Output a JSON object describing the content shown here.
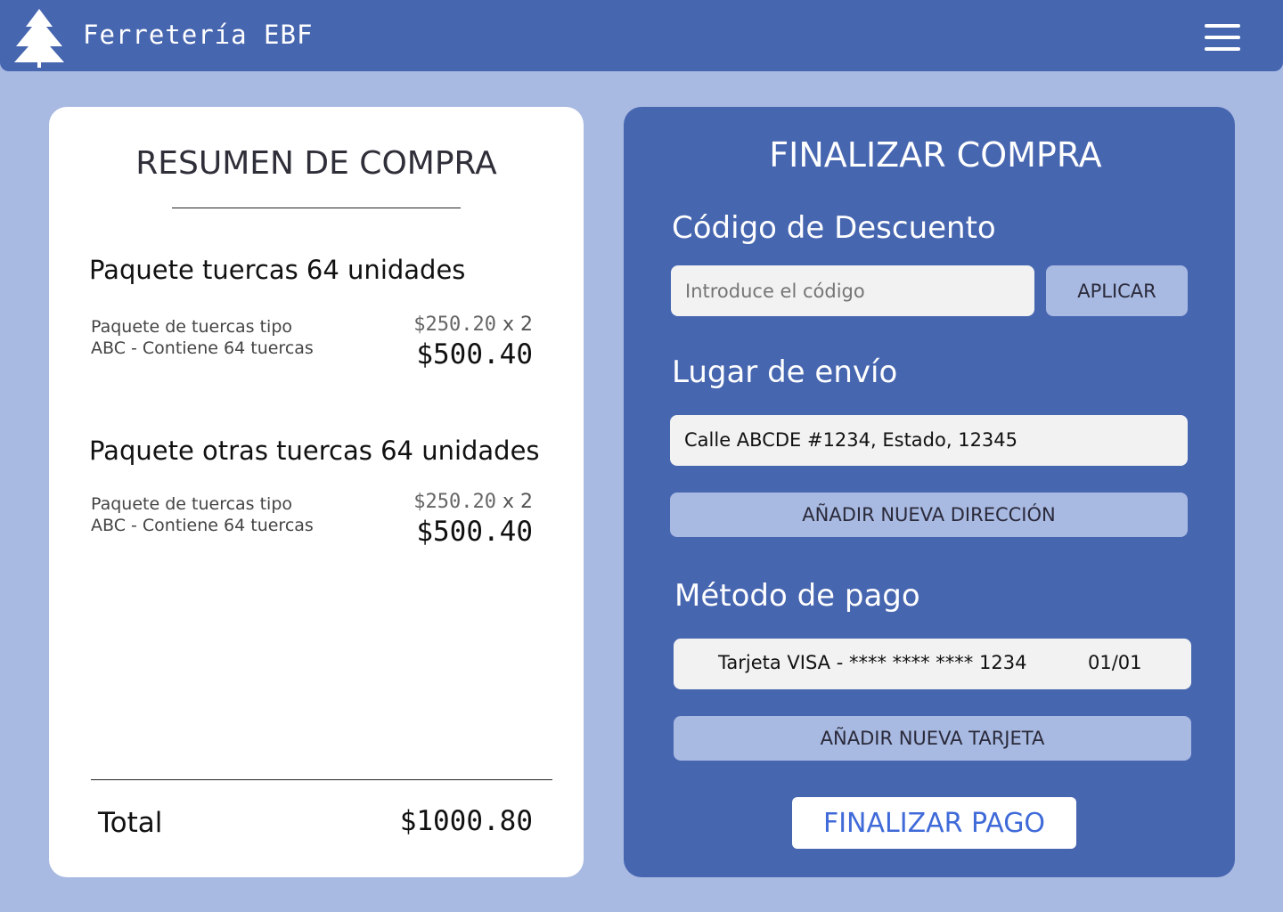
{
  "header": {
    "brand": "Ferretería EBF",
    "logo_icon": "pine-tree-icon",
    "menu_icon": "hamburger-menu-icon",
    "background": "#4766b0"
  },
  "summary": {
    "title": "RESUMEN DE COMPRA",
    "items": [
      {
        "name": "Paquete tuercas 64 unidades",
        "desc_line1": "Paquete de tuercas tipo",
        "desc_line2": "ABC - Contiene 64 tuercas",
        "unit_price": "$250.20",
        "qty": "x 2",
        "line_total": "$500.40"
      },
      {
        "name": "Paquete otras tuercas 64 unidades",
        "desc_line1": "Paquete de tuercas tipo",
        "desc_line2": "ABC - Contiene 64 tuercas",
        "unit_price": "$250.20",
        "qty": "x 2",
        "line_total": "$500.40"
      }
    ],
    "total_label": "Total",
    "total_value": "$1000.80"
  },
  "checkout": {
    "title": "FINALIZAR COMPRA",
    "discount_label": "Código de Descuento",
    "discount_placeholder": "Introduce el código",
    "apply_button": "APLICAR",
    "shipping_label": "Lugar de envío",
    "shipping_address": "Calle ABCDE #1234, Estado, 12345",
    "add_address_button": "AÑADIR NUEVA DIRECCIÓN",
    "payment_label": "Método de pago",
    "card_text": "Tarjeta VISA - **** **** **** 1234",
    "card_expiry": "01/01",
    "add_card_button": "AÑADIR NUEVA TARJETA",
    "finish_button": "FINALIZAR PAGO"
  },
  "colors": {
    "page_bg": "#a8b9e2",
    "primary": "#4766b0",
    "accent_text": "#3f6ad8",
    "field_bg": "#f2f2f2"
  }
}
